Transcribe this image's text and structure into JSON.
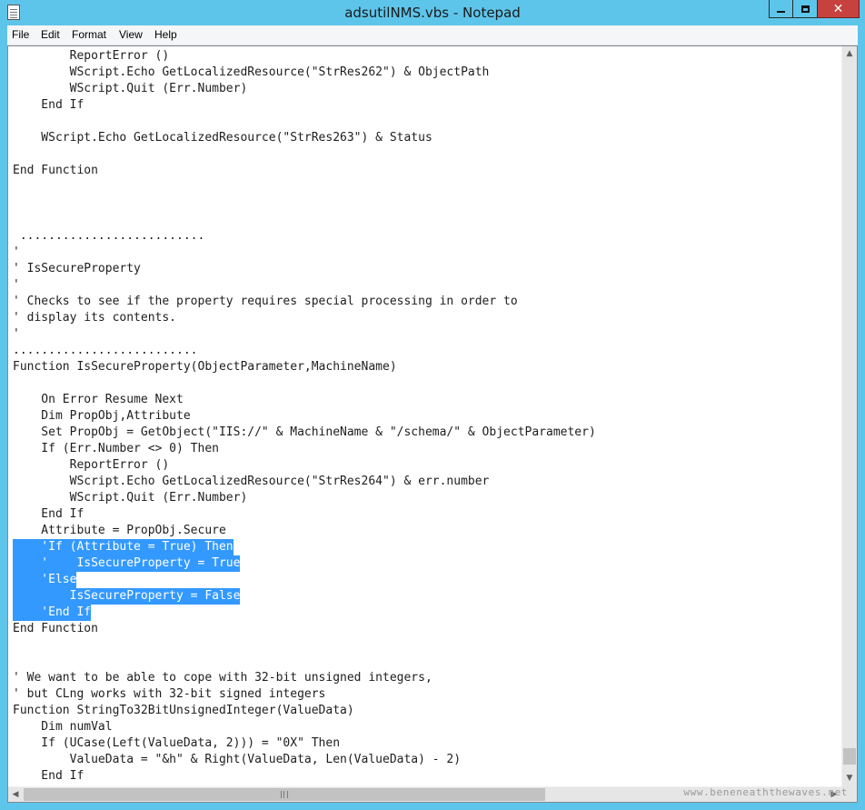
{
  "window": {
    "title": "adsutilNMS.vbs - Notepad",
    "close_glyph": "✕"
  },
  "menu": [
    "File",
    "Edit",
    "Format",
    "View",
    "Help"
  ],
  "editor": {
    "lines": [
      {
        "text": "        ReportError ()",
        "selected": false
      },
      {
        "text": "        WScript.Echo GetLocalizedResource(\"StrRes262\") & ObjectPath",
        "selected": false
      },
      {
        "text": "        WScript.Quit (Err.Number)",
        "selected": false
      },
      {
        "text": "    End If",
        "selected": false
      },
      {
        "text": "",
        "selected": false
      },
      {
        "text": "    WScript.Echo GetLocalizedResource(\"StrRes263\") & Status",
        "selected": false
      },
      {
        "text": "",
        "selected": false
      },
      {
        "text": "End Function",
        "selected": false
      },
      {
        "text": "",
        "selected": false
      },
      {
        "text": "",
        "selected": false
      },
      {
        "text": "",
        "selected": false
      },
      {
        "text": " ..........................",
        "selected": false
      },
      {
        "text": "'",
        "selected": false
      },
      {
        "text": "' IsSecureProperty",
        "selected": false
      },
      {
        "text": "'",
        "selected": false
      },
      {
        "text": "' Checks to see if the property requires special processing in order to",
        "selected": false
      },
      {
        "text": "' display its contents.",
        "selected": false
      },
      {
        "text": "'",
        "selected": false
      },
      {
        "text": "..........................",
        "selected": false
      },
      {
        "text": "Function IsSecureProperty(ObjectParameter,MachineName)",
        "selected": false
      },
      {
        "text": "",
        "selected": false
      },
      {
        "text": "    On Error Resume Next",
        "selected": false
      },
      {
        "text": "    Dim PropObj,Attribute",
        "selected": false
      },
      {
        "text": "    Set PropObj = GetObject(\"IIS://\" & MachineName & \"/schema/\" & ObjectParameter)",
        "selected": false
      },
      {
        "text": "    If (Err.Number <> 0) Then",
        "selected": false
      },
      {
        "text": "        ReportError ()",
        "selected": false
      },
      {
        "text": "        WScript.Echo GetLocalizedResource(\"StrRes264\") & err.number",
        "selected": false
      },
      {
        "text": "        WScript.Quit (Err.Number)",
        "selected": false
      },
      {
        "text": "    End If",
        "selected": false
      },
      {
        "text": "    Attribute = PropObj.Secure",
        "selected": false
      },
      {
        "text": "    'If (Attribute = True) Then",
        "selected": true
      },
      {
        "text": "    '    IsSecureProperty = True",
        "selected": true
      },
      {
        "text": "    'Else",
        "selected": true
      },
      {
        "text": "        IsSecureProperty = False",
        "selected": true
      },
      {
        "text": "    'End If",
        "selected": true
      },
      {
        "text": "End Function",
        "selected": false
      },
      {
        "text": "",
        "selected": false
      },
      {
        "text": "",
        "selected": false
      },
      {
        "text": "' We want to be able to cope with 32-bit unsigned integers,",
        "selected": false
      },
      {
        "text": "' but CLng works with 32-bit signed integers",
        "selected": false
      },
      {
        "text": "Function StringTo32BitUnsignedInteger(ValueData)",
        "selected": false
      },
      {
        "text": "    Dim numVal",
        "selected": false
      },
      {
        "text": "    If (UCase(Left(ValueData, 2))) = \"0X\" Then",
        "selected": false
      },
      {
        "text": "        ValueData = \"&h\" & Right(ValueData, Len(ValueData) - 2)",
        "selected": false
      },
      {
        "text": "    End If",
        "selected": false
      }
    ]
  },
  "scrollbars": {
    "up_arrow": "▲",
    "down_arrow": "▼",
    "left_arrow": "◀",
    "right_arrow": "▶"
  },
  "watermark": "www.beneneaththewaves.net",
  "colors": {
    "title_bar": "#5ec5ea",
    "selection": "#3399ff",
    "close_button": "#c7413e"
  }
}
